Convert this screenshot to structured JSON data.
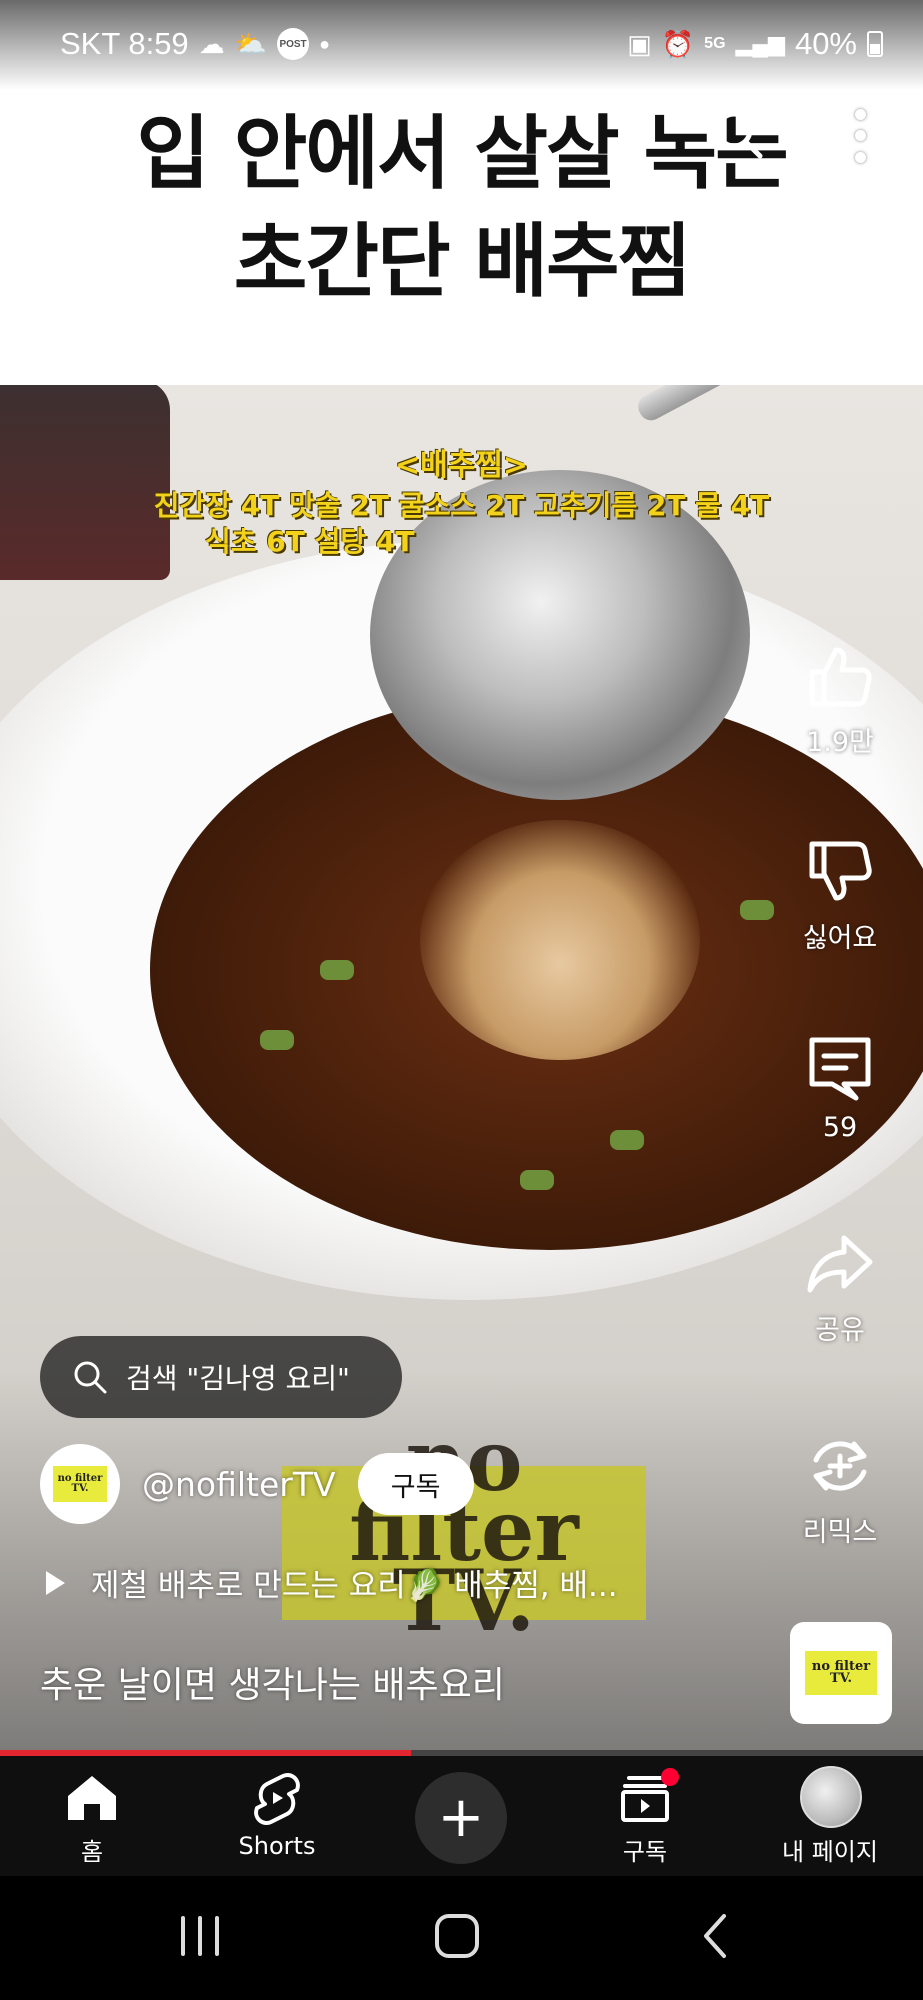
{
  "status_bar": {
    "carrier_time": "SKT 8:59",
    "post_badge": "POST",
    "battery": "40%",
    "network": "5G"
  },
  "video": {
    "headline_line1": "입 안에서 살살 녹는",
    "headline_line2": "초간단 배추찜",
    "recipe_title": "<배추찜>",
    "recipe_line1": "진간장 4T   맛술 2T   굴소스 2T   고추기름 2T   물 4T",
    "recipe_line2": "식초 6T   설탕 4T"
  },
  "actions": {
    "like_count": "1.9만",
    "dislike_label": "싫어요",
    "comment_count": "59",
    "share_label": "공유",
    "remix_label": "리믹스"
  },
  "search_chip": {
    "text": "검색 \"김나영 요리\""
  },
  "channel": {
    "handle": "@nofilterTV",
    "subscribe_label": "구독",
    "logo_text": "no filter TV."
  },
  "playlist": {
    "text": "제철 배추로 만드는 요리🥬 배추찜, 배..."
  },
  "caption": "추운 날이면 생각나는 배추요리",
  "progress_fraction": 0.445,
  "bottom_nav": {
    "home": "홈",
    "shorts": "Shorts",
    "create": "+",
    "subscriptions": "구독",
    "you": "내 페이지"
  },
  "colors": {
    "accent_red": "#e3262f",
    "recipe_yellow": "#f2d21a",
    "logo_yellow": "#e8ea3c"
  },
  "icons": [
    "back-arrow-icon",
    "search-icon",
    "more-vert-icon",
    "thumb-up-icon",
    "thumb-down-icon",
    "comment-icon",
    "share-icon",
    "remix-icon",
    "home-icon",
    "shorts-icon",
    "subscriptions-icon"
  ]
}
